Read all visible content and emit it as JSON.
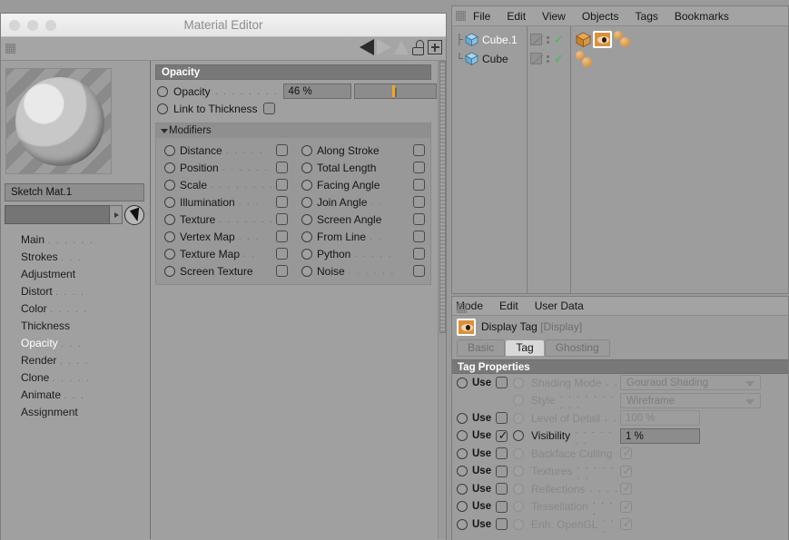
{
  "material_editor": {
    "title": "Material Editor",
    "traffic_lights": [
      "close",
      "minimize",
      "zoom"
    ],
    "toolbar_icons": [
      "back-arrow",
      "forward-arrow",
      "up-arrow",
      "unlock-icon",
      "add-icon"
    ],
    "material_name": "Sketch Mat.1",
    "search_value": "",
    "nav_items": [
      {
        "label": "Main",
        "dots": ". . . . . .",
        "selected": false
      },
      {
        "label": "Strokes",
        "dots": ". . .",
        "selected": false
      },
      {
        "label": "Adjustment",
        "dots": "",
        "selected": false
      },
      {
        "label": "Distort",
        "dots": ". . . .",
        "selected": false
      },
      {
        "label": "Color",
        "dots": ". . . . .",
        "selected": false
      },
      {
        "label": "Thickness",
        "dots": "",
        "selected": false
      },
      {
        "label": "Opacity",
        "dots": ". . .",
        "selected": true
      },
      {
        "label": "Render",
        "dots": ". . . .",
        "selected": false
      },
      {
        "label": "Clone",
        "dots": ". . . . .",
        "selected": false
      },
      {
        "label": "Animate",
        "dots": ". . .",
        "selected": false
      },
      {
        "label": "Assignment",
        "dots": "",
        "selected": false
      }
    ],
    "opacity_group": {
      "title": "Opacity",
      "opacity_label": "Opacity",
      "opacity_dots": ". . . . . . . .",
      "opacity_value": "46 %",
      "slider_percent": 46,
      "link_label": "Link to Thickness",
      "link_checked": false
    },
    "modifiers": {
      "title": "Modifiers",
      "expanded": true,
      "left_column": [
        {
          "label": "Distance",
          "dots": ". . . . .",
          "checked": false
        },
        {
          "label": "Position",
          "dots": ". . . . . .",
          "checked": false
        },
        {
          "label": "Scale",
          "dots": ". . . . . . . .",
          "checked": false
        },
        {
          "label": "Illumination",
          "dots": ". . .",
          "checked": false
        },
        {
          "label": "Texture",
          "dots": ". . . . . . .",
          "checked": false
        },
        {
          "label": "Vertex Map",
          "dots": ". . .",
          "checked": false
        },
        {
          "label": "Texture Map",
          "dots": ". .",
          "checked": false
        },
        {
          "label": "Screen Texture",
          "dots": "",
          "checked": false
        }
      ],
      "right_column": [
        {
          "label": "Along Stroke",
          "dots": "",
          "checked": false
        },
        {
          "label": "Total Length",
          "dots": "",
          "checked": false
        },
        {
          "label": "Facing Angle",
          "dots": "",
          "checked": false
        },
        {
          "label": "Join Angle",
          "dots": ". .",
          "checked": false
        },
        {
          "label": "Screen Angle",
          "dots": "",
          "checked": false
        },
        {
          "label": "From Line",
          "dots": ". .",
          "checked": false
        },
        {
          "label": "Python",
          "dots": ". . . . .",
          "checked": false
        },
        {
          "label": "Noise",
          "dots": ". . . . . .",
          "checked": false
        }
      ]
    }
  },
  "object_manager": {
    "menus": [
      "File",
      "Edit",
      "View",
      "Objects",
      "Tags",
      "Bookmarks"
    ],
    "objects": [
      {
        "name": "Cube.1",
        "selected": true,
        "tags": [
          "cube-tag",
          "display-tag",
          "spheres-tag"
        ],
        "display_tag_selected": true
      },
      {
        "name": "Cube",
        "selected": false,
        "tags": [
          "spheres-tag"
        ],
        "display_tag_selected": false
      }
    ]
  },
  "attribute_manager": {
    "menus": [
      "Mode",
      "Edit",
      "User Data"
    ],
    "header_title": "Display Tag",
    "header_type": "[Display]",
    "tabs": [
      {
        "label": "Basic",
        "active": false
      },
      {
        "label": "Tag",
        "active": true
      },
      {
        "label": "Ghosting",
        "active": false
      }
    ],
    "group_title": "Tag Properties",
    "rows": [
      {
        "use_label": "Use",
        "use_checked": false,
        "use_enabled": true,
        "prop_label": "Shading Mode",
        "prop_dots": ". .",
        "prop_enabled": false,
        "value_type": "dropdown",
        "value": "Gouraud Shading"
      },
      {
        "use_label": "",
        "use_checked": null,
        "use_enabled": false,
        "prop_label": "Style",
        "prop_dots": ". . . . . . . . . .",
        "prop_enabled": false,
        "value_type": "dropdown",
        "value": "Wireframe"
      },
      {
        "use_label": "Use",
        "use_checked": false,
        "use_enabled": true,
        "prop_label": "Level of Detail",
        "prop_dots": ". .",
        "prop_enabled": false,
        "value_type": "number-disabled",
        "value": "100 %"
      },
      {
        "use_label": "Use",
        "use_checked": true,
        "use_enabled": true,
        "prop_label": "Visibility",
        "prop_dots": ". . . . . . .",
        "prop_enabled": true,
        "value_type": "number",
        "value": "1 %"
      },
      {
        "use_label": "Use",
        "use_checked": false,
        "use_enabled": true,
        "prop_label": "Backface Culling",
        "prop_dots": "",
        "prop_enabled": false,
        "value_type": "checkbox",
        "value_checked": true
      },
      {
        "use_label": "Use",
        "use_checked": false,
        "use_enabled": true,
        "prop_label": "Textures",
        "prop_dots": ". . . . . . .",
        "prop_enabled": false,
        "value_type": "checkbox",
        "value_checked": true
      },
      {
        "use_label": "Use",
        "use_checked": false,
        "use_enabled": true,
        "prop_label": "Reflections",
        "prop_dots": ". . . .",
        "prop_enabled": false,
        "value_type": "checkbox",
        "value_checked": true
      },
      {
        "use_label": "Use",
        "use_checked": false,
        "use_enabled": true,
        "prop_label": "Tessellation",
        "prop_dots": ". . . .",
        "prop_enabled": false,
        "value_type": "checkbox",
        "value_checked": true
      },
      {
        "use_label": "Use",
        "use_checked": false,
        "use_enabled": true,
        "prop_label": "Enh. OpenGL",
        "prop_dots": ". . .",
        "prop_enabled": false,
        "value_type": "checkbox",
        "value_checked": true
      }
    ]
  },
  "colors": {
    "window_bg": "#a0a0a0",
    "panel_bg": "#9a9a9a",
    "group_header": "#787878",
    "accent_orange": "#f5a623",
    "tag_orange": "#d8913f",
    "check_green": "#3ac13a",
    "selected_text": "#ffffff"
  }
}
